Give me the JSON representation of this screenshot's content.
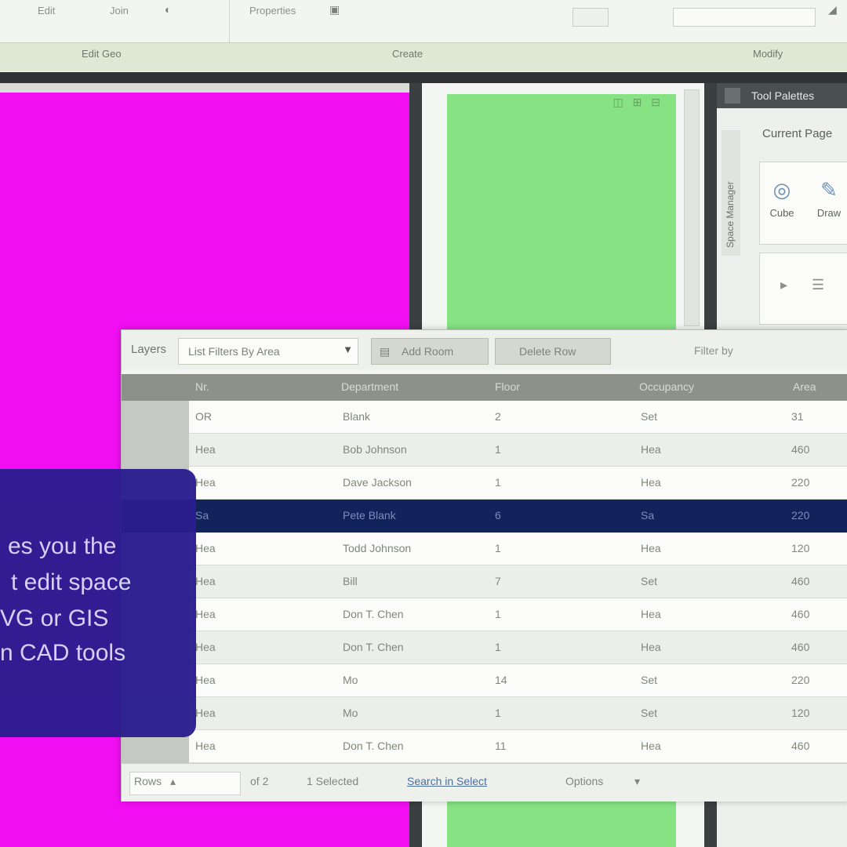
{
  "ribbon": {
    "buttons": [
      "Edit",
      "Join",
      "Properties"
    ],
    "groups": [
      "Edit Geo",
      "Create",
      "Modify"
    ]
  },
  "canvas": {
    "green_icons": "◫ ⊞ ⊟"
  },
  "tool_palette": {
    "title": "Tool Palettes",
    "vertical_tab": "Space Manager",
    "category": "Current Page",
    "tools": [
      {
        "label": "Cube",
        "icon": "cube-icon"
      },
      {
        "label": "Draw",
        "icon": "pencil-icon"
      }
    ]
  },
  "table_window": {
    "toolbar": {
      "label": "Layers",
      "select_value": "List Filters By Area",
      "button1": "Add Room",
      "button2": "Delete Row",
      "filter_text": "Filter by"
    },
    "columns": [
      "Nr.",
      "Department",
      "Floor",
      "Occupancy",
      "Area"
    ],
    "rows": [
      [
        "OR",
        "Blank",
        "2",
        "Set",
        "31"
      ],
      [
        "Hea",
        "Bob Johnson",
        "1",
        "Hea",
        "460"
      ],
      [
        "Hea",
        "Dave Jackson",
        "1",
        "Hea",
        "220"
      ],
      [
        "Sa",
        "Pete Blank",
        "6",
        "Sa",
        "220"
      ],
      [
        "Hea",
        "Todd Johnson",
        "1",
        "Hea",
        "120"
      ],
      [
        "Hea",
        "Bill",
        "7",
        "Set",
        "460"
      ],
      [
        "Hea",
        "Don T. Chen",
        "1",
        "Hea",
        "460"
      ],
      [
        "Hea",
        "Don T. Chen",
        "1",
        "Hea",
        "460"
      ],
      [
        "Hea",
        "Mo",
        "14",
        "Set",
        "220"
      ],
      [
        "Hea",
        "Mo",
        "1",
        "Set",
        "120"
      ],
      [
        "Hea",
        "Don T. Chen",
        "11",
        "Hea",
        "460"
      ]
    ],
    "selected_row_index": 3,
    "footer": {
      "rows_label": "Rows",
      "count": "of 2",
      "selected": "1 Selected",
      "link": "Search in Select",
      "options": "Options"
    }
  },
  "overlay_caption": {
    "lines": [
      "es you the",
      "t edit space",
      "VG or GIS",
      "n CAD tools"
    ]
  },
  "colors": {
    "magenta": "#f20ef2",
    "green": "#86e283",
    "selected_row": "#12225a",
    "overlay": "#2a1d8f"
  }
}
